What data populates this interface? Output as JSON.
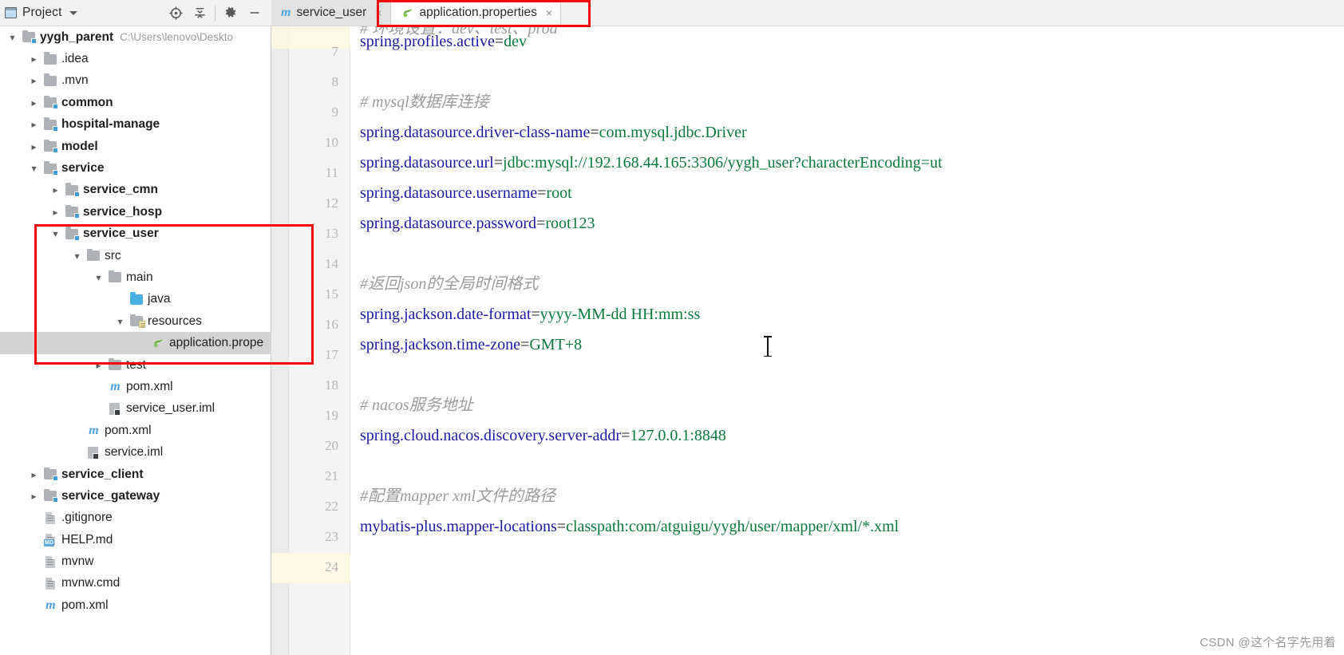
{
  "project_panel": {
    "title": "Project",
    "icons": [
      "locate-icon",
      "collapse-all-icon",
      "settings-gear-icon",
      "minimize-icon"
    ],
    "tree": [
      {
        "label": "yygh_parent",
        "path": "C:\\Users\\lenovo\\Deskto",
        "depth": 0,
        "arrow": "down",
        "icon": "module-folder-icon",
        "bold": true,
        "selected": false
      },
      {
        "label": ".idea",
        "path": "",
        "depth": 1,
        "arrow": "right",
        "icon": "folder-icon",
        "bold": false,
        "selected": false
      },
      {
        "label": ".mvn",
        "path": "",
        "depth": 1,
        "arrow": "right",
        "icon": "folder-icon",
        "bold": false,
        "selected": false
      },
      {
        "label": "common",
        "path": "",
        "depth": 1,
        "arrow": "right",
        "icon": "module-folder-icon",
        "bold": true,
        "selected": false
      },
      {
        "label": "hospital-manage",
        "path": "",
        "depth": 1,
        "arrow": "right",
        "icon": "module-folder-icon",
        "bold": true,
        "selected": false
      },
      {
        "label": "model",
        "path": "",
        "depth": 1,
        "arrow": "right",
        "icon": "module-folder-icon",
        "bold": true,
        "selected": false
      },
      {
        "label": "service",
        "path": "",
        "depth": 1,
        "arrow": "down",
        "icon": "module-folder-icon",
        "bold": true,
        "selected": false
      },
      {
        "label": "service_cmn",
        "path": "",
        "depth": 2,
        "arrow": "right",
        "icon": "module-folder-icon",
        "bold": true,
        "selected": false
      },
      {
        "label": "service_hosp",
        "path": "",
        "depth": 2,
        "arrow": "right",
        "icon": "module-folder-icon",
        "bold": true,
        "selected": false
      },
      {
        "label": "service_user",
        "path": "",
        "depth": 2,
        "arrow": "down",
        "icon": "module-folder-icon",
        "bold": true,
        "selected": false
      },
      {
        "label": "src",
        "path": "",
        "depth": 3,
        "arrow": "down",
        "icon": "folder-icon",
        "bold": false,
        "selected": false
      },
      {
        "label": "main",
        "path": "",
        "depth": 4,
        "arrow": "down",
        "icon": "folder-icon",
        "bold": false,
        "selected": false
      },
      {
        "label": "java",
        "path": "",
        "depth": 5,
        "arrow": "none",
        "icon": "source-folder-icon",
        "bold": false,
        "selected": false
      },
      {
        "label": "resources",
        "path": "",
        "depth": 5,
        "arrow": "down",
        "icon": "resources-folder-icon",
        "bold": false,
        "selected": false
      },
      {
        "label": "application.prope",
        "path": "",
        "depth": 6,
        "arrow": "none",
        "icon": "spring-properties-icon",
        "bold": false,
        "selected": true
      },
      {
        "label": "test",
        "path": "",
        "depth": 4,
        "arrow": "right",
        "icon": "folder-icon",
        "bold": false,
        "selected": false
      },
      {
        "label": "pom.xml",
        "path": "",
        "depth": 4,
        "arrow": "none",
        "icon": "maven-pom-icon",
        "bold": false,
        "selected": false
      },
      {
        "label": "service_user.iml",
        "path": "",
        "depth": 4,
        "arrow": "none",
        "icon": "iml-module-icon",
        "bold": false,
        "selected": false
      },
      {
        "label": "pom.xml",
        "path": "",
        "depth": 3,
        "arrow": "none",
        "icon": "maven-pom-icon",
        "bold": false,
        "selected": false
      },
      {
        "label": "service.iml",
        "path": "",
        "depth": 3,
        "arrow": "none",
        "icon": "iml-module-icon",
        "bold": false,
        "selected": false
      },
      {
        "label": "service_client",
        "path": "",
        "depth": 1,
        "arrow": "right",
        "icon": "module-folder-icon",
        "bold": true,
        "selected": false
      },
      {
        "label": "service_gateway",
        "path": "",
        "depth": 1,
        "arrow": "right",
        "icon": "module-folder-icon",
        "bold": true,
        "selected": false
      },
      {
        "label": ".gitignore",
        "path": "",
        "depth": 1,
        "arrow": "none",
        "icon": "file-icon",
        "bold": false,
        "selected": false
      },
      {
        "label": "HELP.md",
        "path": "",
        "depth": 1,
        "arrow": "none",
        "icon": "markdown-file-icon",
        "bold": false,
        "selected": false
      },
      {
        "label": "mvnw",
        "path": "",
        "depth": 1,
        "arrow": "none",
        "icon": "file-icon",
        "bold": false,
        "selected": false
      },
      {
        "label": "mvnw.cmd",
        "path": "",
        "depth": 1,
        "arrow": "none",
        "icon": "file-icon",
        "bold": false,
        "selected": false
      },
      {
        "label": "pom.xml",
        "path": "",
        "depth": 1,
        "arrow": "none",
        "icon": "maven-pom-icon",
        "bold": false,
        "selected": false
      }
    ]
  },
  "tabs": [
    {
      "label": "service_user",
      "icon": "maven-pom-icon",
      "active": false,
      "close": "×"
    },
    {
      "label": "application.properties",
      "icon": "spring-properties-icon",
      "active": true,
      "close": "×"
    }
  ],
  "editor": {
    "first_visible_line": 7,
    "last_visible_line": 24,
    "highlighted_line": 24,
    "line_numbers": [
      7,
      8,
      9,
      10,
      11,
      12,
      13,
      14,
      15,
      16,
      17,
      18,
      19,
      20,
      21,
      22,
      23,
      24
    ],
    "partial_top_comment": "# 环境设置：dev、test、prod",
    "lines": [
      {
        "n": 7,
        "type": "prop",
        "key": "spring.profiles.active",
        "value": "dev"
      },
      {
        "n": 8,
        "type": "blank",
        "text": ""
      },
      {
        "n": 9,
        "type": "comment",
        "text": "# mysql数据库连接"
      },
      {
        "n": 10,
        "type": "prop",
        "key": "spring.datasource.driver-class-name",
        "value": "com.mysql.jdbc.Driver"
      },
      {
        "n": 11,
        "type": "prop",
        "key": "spring.datasource.url",
        "value": "jdbc:mysql://192.168.44.165:3306/yygh_user?characterEncoding=ut"
      },
      {
        "n": 12,
        "type": "prop",
        "key": "spring.datasource.username",
        "value": "root"
      },
      {
        "n": 13,
        "type": "prop",
        "key": "spring.datasource.password",
        "value": "root123"
      },
      {
        "n": 14,
        "type": "blank",
        "text": ""
      },
      {
        "n": 15,
        "type": "comment",
        "text": "#返回json的全局时间格式"
      },
      {
        "n": 16,
        "type": "prop",
        "key": "spring.jackson.date-format",
        "value": "yyyy-MM-dd HH:mm:ss"
      },
      {
        "n": 17,
        "type": "prop",
        "key": "spring.jackson.time-zone",
        "value": "GMT+8"
      },
      {
        "n": 18,
        "type": "blank",
        "text": ""
      },
      {
        "n": 19,
        "type": "comment",
        "text": "# nacos服务地址"
      },
      {
        "n": 20,
        "type": "prop",
        "key": "spring.cloud.nacos.discovery.server-addr",
        "value": "127.0.0.1:8848"
      },
      {
        "n": 21,
        "type": "blank",
        "text": ""
      },
      {
        "n": 22,
        "type": "comment",
        "text": "#配置mapper xml文件的路径"
      },
      {
        "n": 23,
        "type": "prop",
        "key": "mybatis-plus.mapper-locations",
        "value": "classpath:com/atguigu/yygh/user/mapper/xml/*.xml"
      },
      {
        "n": 24,
        "type": "blank",
        "text": ""
      }
    ]
  },
  "annotations": {
    "box_color": "#fb0007",
    "boxes": [
      "tree-service-user-highlight",
      "tab-application-properties-highlight"
    ]
  },
  "watermark": "CSDN @这个名字先用着"
}
